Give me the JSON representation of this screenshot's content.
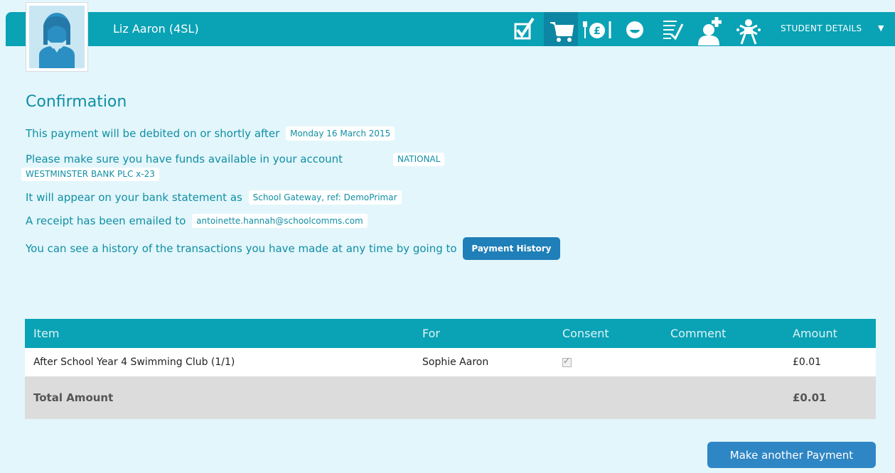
{
  "header": {
    "student_name": "Liz Aaron (4SL)",
    "student_details_label": "STUDENT DETAILS",
    "icons": [
      "checkbox-icon",
      "cart-icon",
      "dinner-money-icon",
      "smiley-icon",
      "notes-icon",
      "medical-icon",
      "club-icon"
    ],
    "active_icon": "cart-icon"
  },
  "confirmation": {
    "title": "Confirmation",
    "debit_text": "This payment will be debited on or shortly after",
    "debit_date": "Monday 16 March 2015",
    "funds_text": "Please make sure you have funds available in your account",
    "account_line1": "NATIONAL",
    "account_line2": "WESTMINSTER BANK PLC x-23",
    "statement_text": "It will appear on your bank statement as",
    "statement_ref": "School Gateway, ref: DemoPrimar",
    "receipt_text": "A receipt has been emailed to",
    "receipt_email": "antoinette.hannah@schoolcomms.com",
    "history_text": "You can see a history of the transactions you have made at any time by going to",
    "history_button": "Payment History"
  },
  "table": {
    "headers": {
      "item": "Item",
      "for": "For",
      "consent": "Consent",
      "comment": "Comment",
      "amount": "Amount"
    },
    "rows": [
      {
        "item": "After School Year 4 Swimming Club (1/1)",
        "for": "Sophie Aaron",
        "consent": true,
        "comment": "",
        "amount": "£0.01"
      }
    ],
    "total_label": "Total Amount",
    "total_amount": "£0.01"
  },
  "actions": {
    "make_another": "Make another Payment"
  },
  "colors": {
    "teal": "#0aa2b5",
    "text_teal": "#0f8fa4",
    "button_blue": "#1f7fb8",
    "background": "#e3f6fb"
  }
}
